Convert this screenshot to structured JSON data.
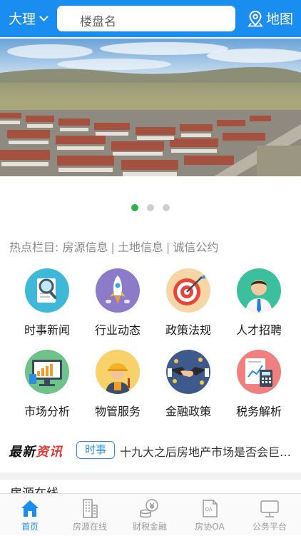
{
  "header": {
    "city": "大理",
    "search_placeholder": "楼盘名",
    "map_label": "地图"
  },
  "carousel": {
    "slide_count": 3,
    "active_index": 0
  },
  "hot_topics": {
    "prefix": "热点栏目:",
    "links": [
      "房源信息",
      "土地信息",
      "诚信公约"
    ]
  },
  "categories": [
    {
      "label": "时事新闻",
      "icon": "news-magnifier-icon"
    },
    {
      "label": "行业动态",
      "icon": "rocket-icon"
    },
    {
      "label": "政策法规",
      "icon": "target-icon"
    },
    {
      "label": "人才招聘",
      "icon": "businessman-icon"
    },
    {
      "label": "市场分析",
      "icon": "chart-monitor-icon"
    },
    {
      "label": "物管服务",
      "icon": "worker-icon"
    },
    {
      "label": "金融政策",
      "icon": "handshake-icon"
    },
    {
      "label": "税务解析",
      "icon": "calculator-icon"
    }
  ],
  "news": {
    "brand_part1": "最新",
    "brand_part2": "资讯",
    "tag": "时事",
    "headline": "十九大之后房地产市场是否会巨…"
  },
  "section_peek": "房源在线",
  "tabbar": [
    {
      "label": "首页",
      "active": true
    },
    {
      "label": "房源在线",
      "active": false
    },
    {
      "label": "财税金融",
      "active": false
    },
    {
      "label": "房协OA",
      "active": false
    },
    {
      "label": "公务平台",
      "active": false
    }
  ],
  "colors": {
    "primary": "#1a8ef0",
    "dot_active": "#2ab24a",
    "brand_red": "#e53935"
  }
}
